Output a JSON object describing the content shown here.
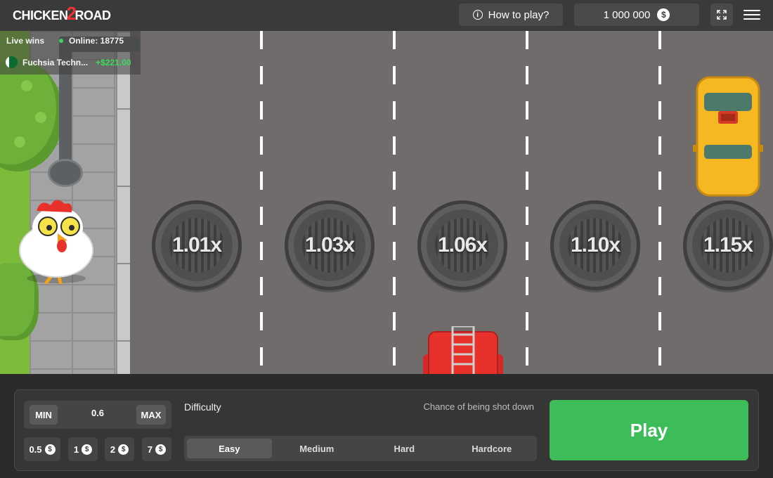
{
  "header": {
    "logo_part1": "CHICKEN",
    "logo_part2": "2",
    "logo_part3": "ROAD",
    "how_to_play_label": "How to play?",
    "balance": "1 000 000",
    "currency_symbol": "$"
  },
  "live_wins": {
    "title": "Live wins",
    "online_label": "Online: 18775",
    "entries": [
      {
        "user": "Fuchsia Techn...",
        "amount": "+$221.00"
      }
    ]
  },
  "lanes": {
    "multipliers": [
      "1.01x",
      "1.03x",
      "1.06x",
      "1.10x",
      "1.15x"
    ]
  },
  "bet": {
    "min_label": "MIN",
    "max_label": "MAX",
    "value": "0.6",
    "quick_bets": [
      "0.5",
      "1",
      "2",
      "7"
    ]
  },
  "difficulty": {
    "title": "Difficulty",
    "chance_label": "Chance of being shot down",
    "options": [
      "Easy",
      "Medium",
      "Hard",
      "Hardcore"
    ],
    "selected": "Easy"
  },
  "play_label": "Play",
  "colors": {
    "play_green": "#3dbd5a",
    "road": "#706c6b",
    "win_green": "#3ddc5c"
  }
}
